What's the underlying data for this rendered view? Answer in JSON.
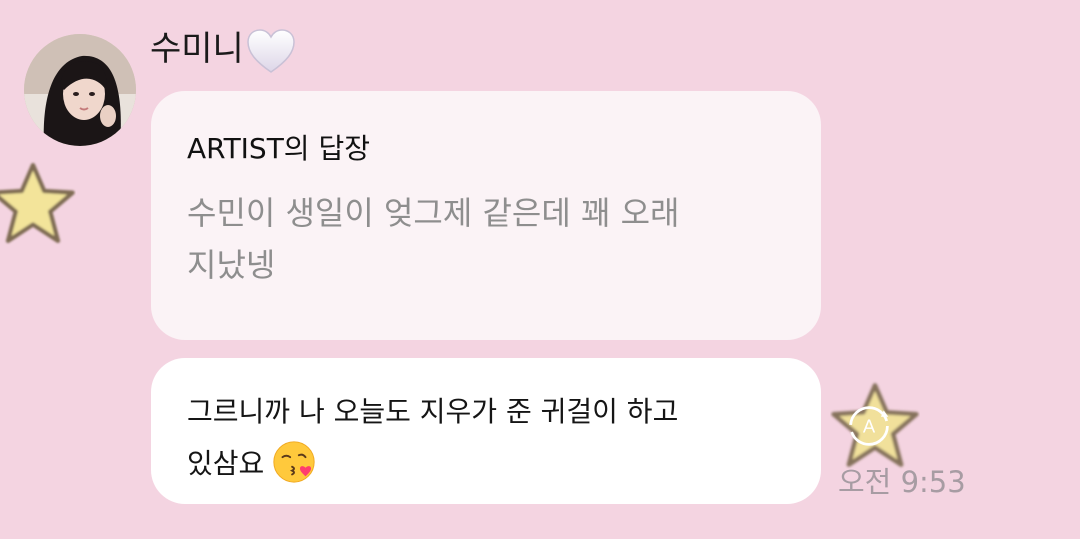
{
  "chat": {
    "sender_name": "수미니",
    "reply": {
      "title": "ARTIST의 답장",
      "quote_lines": [
        "수민이 생일이 엊그제 같은데 꽤 오래",
        "지났넹"
      ]
    },
    "message": {
      "lines": [
        "그르니까 나 오늘도 지우가 준 귀걸이 하고",
        "있삼요"
      ],
      "emoji": "kiss-emoji"
    },
    "translate_icon_label": "A",
    "timestamp": "오전 9:53"
  },
  "colors": {
    "background": "#f4d4e1",
    "reply_bubble": "#fbf3f6",
    "message_bubble": "#ffffff",
    "quote_text": "#8e8e8e",
    "timestamp": "#a79ca3",
    "star": "#f1e48a"
  },
  "icons": [
    "white-heart-icon",
    "avatar",
    "star-sticker-icon",
    "translate-icon",
    "kiss-emoji"
  ]
}
